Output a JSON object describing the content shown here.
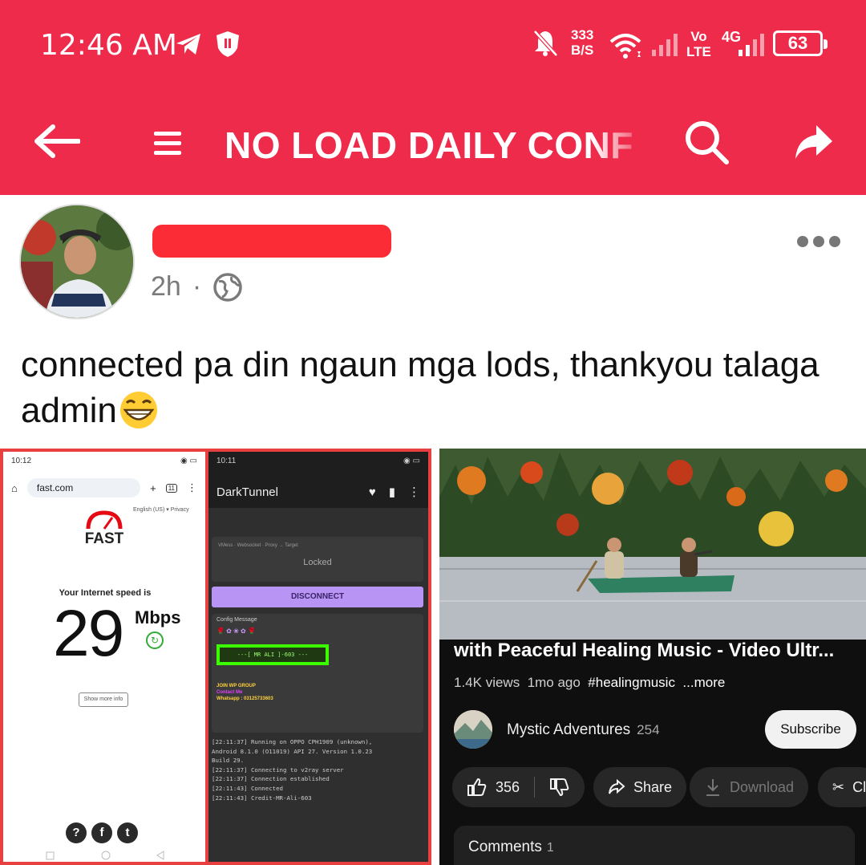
{
  "status_bar": {
    "time": "12:46 AM",
    "net_speed_value": "333",
    "net_speed_unit": "B/S",
    "volte_top": "Vo",
    "volte_bottom": "LTE",
    "network": "4G",
    "battery": "63"
  },
  "app_bar": {
    "title": "NO LOAD DAILY CONF"
  },
  "post": {
    "time": "2h",
    "separator": "·",
    "text": "connected pa din ngaun mga lods, thankyou talaga admin"
  },
  "fast_com": {
    "status_time": "10:12",
    "url": "fast.com",
    "tab_count": "11",
    "lang": "English (US) ▾   Privacy",
    "logo": "FAST",
    "speed_label": "Your Internet speed is",
    "speed_value": "29",
    "speed_unit": "Mbps",
    "more_info": "Show more info",
    "social": [
      "?",
      "f",
      "t"
    ]
  },
  "dark_tunnel": {
    "status_time": "10:11",
    "app_name": "DarkTunnel",
    "protocol": "VMess  ·  Websocket  ·  Proxy → Target",
    "locked": "Locked",
    "disconnect": "DISCONNECT",
    "config_label": "Config Message",
    "config_box": "---[ MR ALI ]-603 ---",
    "ad_group": "JOIN WP GROUP",
    "ad_contact": "Contact Me",
    "ad_whatsapp": "Whatsapp : 03125733603",
    "log": "[22:11:37] Running on OPPO CPH1909 (unknown),\nAndroid 8.1.0 (O11019) API 27. Version 1.0.23\nBuild 29.\n[22:11:37] Connecting to v2ray server\n[22:11:37] Connection established\n[22:11:43] Connected\n[22:11:43] Credit-MR-Ali-603"
  },
  "youtube": {
    "title": "with Peaceful Healing Music - Video Ultr...",
    "views": "1.4K views",
    "age": "1mo ago",
    "tag": "#healingmusic",
    "more": "...more",
    "channel": "Mystic Adventures",
    "subscribers": "254",
    "subscribe": "Subscribe",
    "likes": "356",
    "share": "Share",
    "download": "Download",
    "clip": "Cl",
    "comments_label": "Comments",
    "comments_count": "1"
  },
  "colors": {
    "brand": "#ee2b4a",
    "redaction": "#fb2c36",
    "yt_bg": "#0f0f0f",
    "dt_button": "#b894f5"
  },
  "icons": [
    "back-arrow-icon",
    "menu-icon",
    "search-icon",
    "share-icon",
    "globe-icon",
    "more-dots-icon",
    "telegram-icon",
    "shield-icon",
    "mute-bell-icon",
    "wifi-icon",
    "signal-icon"
  ]
}
